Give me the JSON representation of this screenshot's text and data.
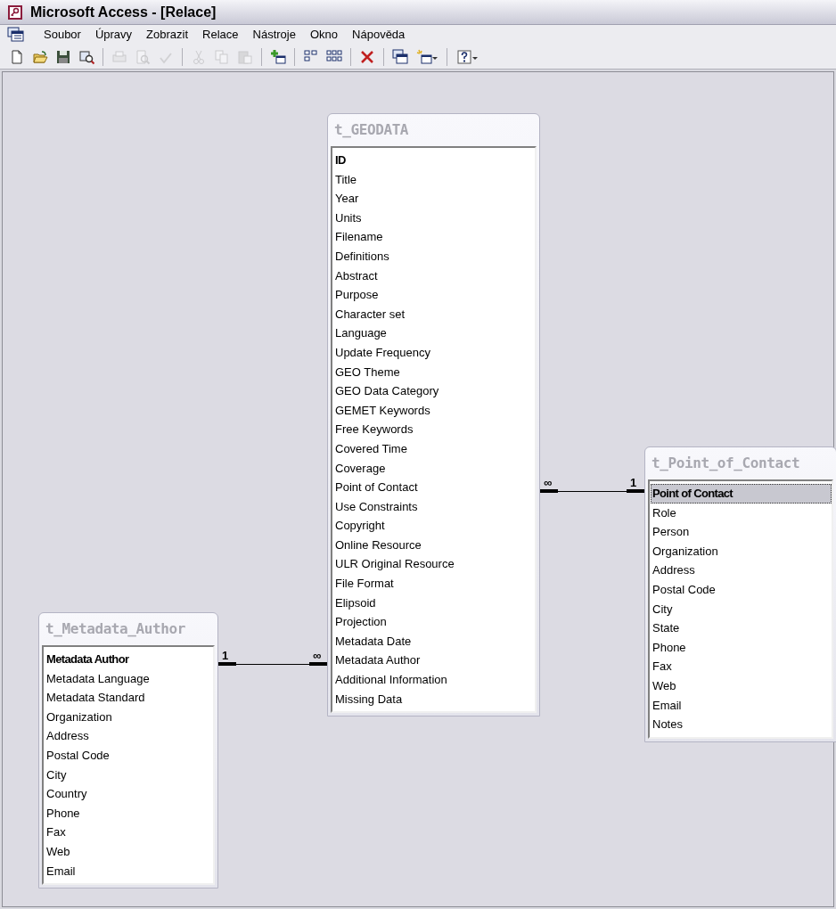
{
  "window": {
    "title": "Microsoft Access - [Relace]"
  },
  "menu": [
    {
      "label": "Soubor"
    },
    {
      "label": "Úpravy"
    },
    {
      "label": "Zobrazit"
    },
    {
      "label": "Relace"
    },
    {
      "label": "Nástroje"
    },
    {
      "label": "Okno"
    },
    {
      "label": "Nápověda"
    }
  ],
  "toolbar": [
    {
      "kind": "new",
      "disabled": false
    },
    {
      "kind": "open",
      "disabled": false
    },
    {
      "kind": "save",
      "disabled": false
    },
    {
      "kind": "search",
      "disabled": false
    },
    {
      "kind": "separator"
    },
    {
      "kind": "print",
      "disabled": true
    },
    {
      "kind": "preview",
      "disabled": true
    },
    {
      "kind": "spell",
      "disabled": true
    },
    {
      "kind": "separator"
    },
    {
      "kind": "cut",
      "disabled": true
    },
    {
      "kind": "copy",
      "disabled": true
    },
    {
      "kind": "paste",
      "disabled": true
    },
    {
      "kind": "separator"
    },
    {
      "kind": "addtable",
      "disabled": false
    },
    {
      "kind": "separator"
    },
    {
      "kind": "direct",
      "disabled": false
    },
    {
      "kind": "all",
      "disabled": false
    },
    {
      "kind": "separator"
    },
    {
      "kind": "delete",
      "disabled": false
    },
    {
      "kind": "separator"
    },
    {
      "kind": "dbwindow",
      "disabled": false
    },
    {
      "kind": "newobject",
      "disabled": false
    },
    {
      "kind": "separator"
    },
    {
      "kind": "help",
      "disabled": false
    }
  ],
  "tables": [
    {
      "title": "t_GEODATA",
      "fields": [
        {
          "name": "ID",
          "key": true,
          "selected": false
        },
        {
          "name": "Title",
          "key": false,
          "selected": false
        },
        {
          "name": "Year",
          "key": false,
          "selected": false
        },
        {
          "name": "Units",
          "key": false,
          "selected": false
        },
        {
          "name": "Filename",
          "key": false,
          "selected": false
        },
        {
          "name": "Definitions",
          "key": false,
          "selected": false
        },
        {
          "name": "Abstract",
          "key": false,
          "selected": false
        },
        {
          "name": "Purpose",
          "key": false,
          "selected": false
        },
        {
          "name": "Character set",
          "key": false,
          "selected": false
        },
        {
          "name": "Language",
          "key": false,
          "selected": false
        },
        {
          "name": "Update Frequency",
          "key": false,
          "selected": false
        },
        {
          "name": "GEO Theme",
          "key": false,
          "selected": false
        },
        {
          "name": "GEO Data Category",
          "key": false,
          "selected": false
        },
        {
          "name": "GEMET Keywords",
          "key": false,
          "selected": false
        },
        {
          "name": "Free Keywords",
          "key": false,
          "selected": false
        },
        {
          "name": "Covered Time",
          "key": false,
          "selected": false
        },
        {
          "name": "Coverage",
          "key": false,
          "selected": false
        },
        {
          "name": "Point of Contact",
          "key": false,
          "selected": false
        },
        {
          "name": "Use Constraints",
          "key": false,
          "selected": false
        },
        {
          "name": "Copyright",
          "key": false,
          "selected": false
        },
        {
          "name": "Online Resource",
          "key": false,
          "selected": false
        },
        {
          "name": "ULR Original Resource",
          "key": false,
          "selected": false
        },
        {
          "name": "File Format",
          "key": false,
          "selected": false
        },
        {
          "name": "Elipsoid",
          "key": false,
          "selected": false
        },
        {
          "name": "Projection",
          "key": false,
          "selected": false
        },
        {
          "name": "Metadata Date",
          "key": false,
          "selected": false
        },
        {
          "name": "Metadata Author",
          "key": false,
          "selected": false
        },
        {
          "name": "Additional Information",
          "key": false,
          "selected": false
        },
        {
          "name": "Missing Data",
          "key": false,
          "selected": false
        }
      ]
    },
    {
      "title": "t_Point_of_Contact",
      "fields": [
        {
          "name": "Point of Contact",
          "key": true,
          "selected": true
        },
        {
          "name": "Role",
          "key": false,
          "selected": false
        },
        {
          "name": "Person",
          "key": false,
          "selected": false
        },
        {
          "name": "Organization",
          "key": false,
          "selected": false
        },
        {
          "name": "Address",
          "key": false,
          "selected": false
        },
        {
          "name": "Postal Code",
          "key": false,
          "selected": false
        },
        {
          "name": "City",
          "key": false,
          "selected": false
        },
        {
          "name": "State",
          "key": false,
          "selected": false
        },
        {
          "name": "Phone",
          "key": false,
          "selected": false
        },
        {
          "name": "Fax",
          "key": false,
          "selected": false
        },
        {
          "name": "Web",
          "key": false,
          "selected": false
        },
        {
          "name": "Email",
          "key": false,
          "selected": false
        },
        {
          "name": "Notes",
          "key": false,
          "selected": false
        }
      ]
    },
    {
      "title": "t_Metadata_Author",
      "fields": [
        {
          "name": "Metadata Author",
          "key": true,
          "selected": false
        },
        {
          "name": "Metadata Language",
          "key": false,
          "selected": false
        },
        {
          "name": "Metadata Standard",
          "key": false,
          "selected": false
        },
        {
          "name": "Organization",
          "key": false,
          "selected": false
        },
        {
          "name": "Address",
          "key": false,
          "selected": false
        },
        {
          "name": "Postal Code",
          "key": false,
          "selected": false
        },
        {
          "name": "City",
          "key": false,
          "selected": false
        },
        {
          "name": "Country",
          "key": false,
          "selected": false
        },
        {
          "name": "Phone",
          "key": false,
          "selected": false
        },
        {
          "name": "Fax",
          "key": false,
          "selected": false
        },
        {
          "name": "Web",
          "key": false,
          "selected": false
        },
        {
          "name": "Email",
          "key": false,
          "selected": false
        }
      ]
    }
  ],
  "relationships": [
    {
      "left_label": "∞",
      "right_label": "1"
    },
    {
      "left_label": "1",
      "right_label": "∞"
    }
  ]
}
